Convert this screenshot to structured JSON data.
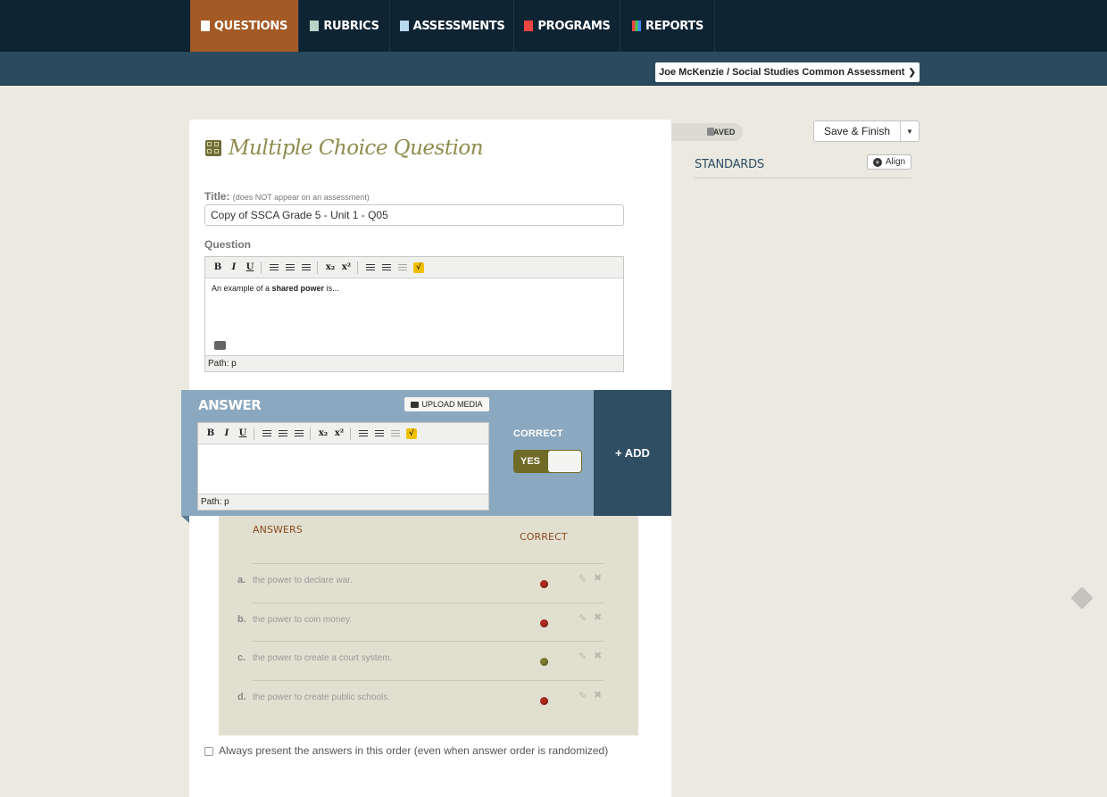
{
  "nav": {
    "tabs": [
      {
        "label": "QUESTIONS",
        "icon": "page-icon",
        "active": true
      },
      {
        "label": "RUBRICS",
        "icon": "rubric-icon",
        "active": false
      },
      {
        "label": "ASSESSMENTS",
        "icon": "document-icon",
        "active": false
      },
      {
        "label": "PROGRAMS",
        "icon": "book-icon",
        "active": false
      },
      {
        "label": "REPORTS",
        "icon": "bar-chart-icon",
        "active": false
      }
    ],
    "user_context": "Joe McKenzie / Social Studies Common Assessment"
  },
  "question": {
    "heading": "Multiple Choice Question",
    "title_label": "Title:",
    "title_note": "(does NOT appear on an assessment)",
    "title_value": "Copy of SSCA Grade 5 - Unit 1 - Q05",
    "question_label": "Question",
    "body_prefix": "An example of a ",
    "body_bold": "shared power",
    "body_suffix": " is...",
    "path": "Path: p"
  },
  "answer_editor": {
    "title": "ANSWER",
    "upload_label": "UPLOAD MEDIA",
    "correct_label": "CORRECT",
    "toggle_label": "YES",
    "toggle_on": true,
    "path": "Path: p",
    "add_label": "+ ADD"
  },
  "answers": {
    "col_answers": "ANSWERS",
    "col_correct": "CORRECT",
    "rows": [
      {
        "letter": "a.",
        "text": "the power to declare war.",
        "correct": false
      },
      {
        "letter": "b.",
        "text": "the power to coin money.",
        "correct": false
      },
      {
        "letter": "c.",
        "text": "the power to create a court system.",
        "correct": true
      },
      {
        "letter": "d.",
        "text": "the power to create public schools.",
        "correct": false
      }
    ],
    "order_checkbox_label": "Always present the answers in this order (even when answer order is randomized)",
    "order_checked": false
  },
  "sidebar": {
    "saved_label": "SAVED",
    "save_finish_label": "Save & Finish",
    "standards_label": "STANDARDS",
    "align_label": "Align"
  },
  "colors": {
    "nav_bg": "#0f2433",
    "active_tab": "#a45a24",
    "answer_panel": "#8aa8bf",
    "add_button": "#2f4e64",
    "incorrect_dot": "#b02a1e",
    "correct_dot": "#7f7c32"
  }
}
